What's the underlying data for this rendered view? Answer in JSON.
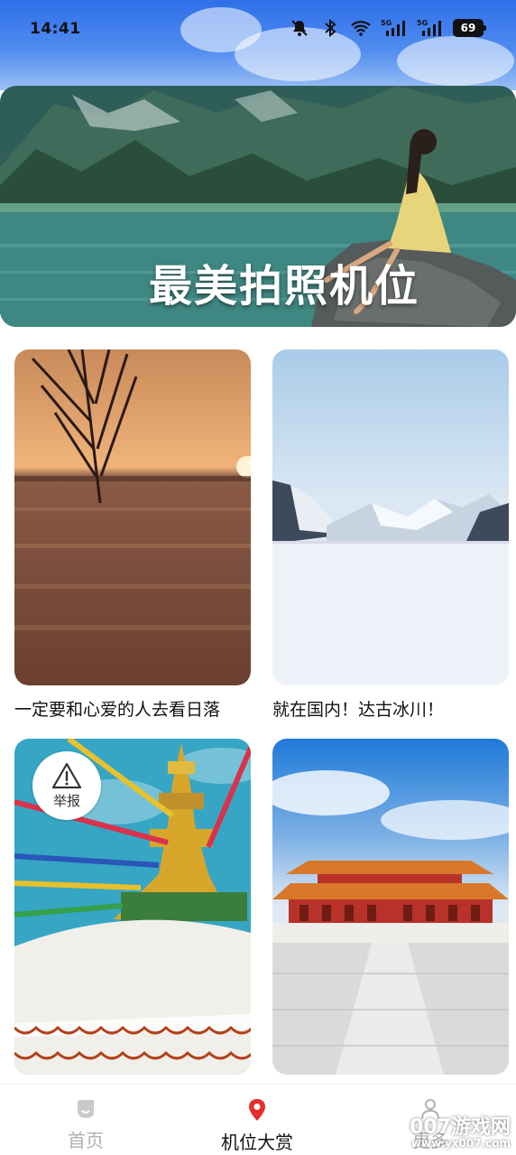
{
  "status_bar": {
    "time": "14:41",
    "battery": "69",
    "icons": [
      "bell-off-icon",
      "bluetooth-icon",
      "wifi-icon",
      "5g-signal-icon",
      "5g-signal-icon"
    ]
  },
  "banner": {
    "title": "最美拍照机位"
  },
  "cards": [
    {
      "caption": "一定要和心爱的人去看日落"
    },
    {
      "caption": "就在国内！达古冰川！"
    },
    {
      "caption": ""
    },
    {
      "caption": ""
    }
  ],
  "report": {
    "label": "举报",
    "icon": "warning-icon"
  },
  "bottom_nav": {
    "items": [
      {
        "label": "首页",
        "icon": "home-icon",
        "color": "#b0b0b0",
        "active": false
      },
      {
        "label": "机位大赏",
        "icon": "location-pin-icon",
        "color": "#e62e2e",
        "active": true
      },
      {
        "label": "更多",
        "icon": "person-icon",
        "color": "#b0b0b0",
        "active": false
      }
    ]
  },
  "watermark": {
    "main": "007游戏网",
    "sub": "www.yx007.com"
  },
  "colors": {
    "accent": "#e62e2e",
    "inactive": "#b0b0b0"
  }
}
